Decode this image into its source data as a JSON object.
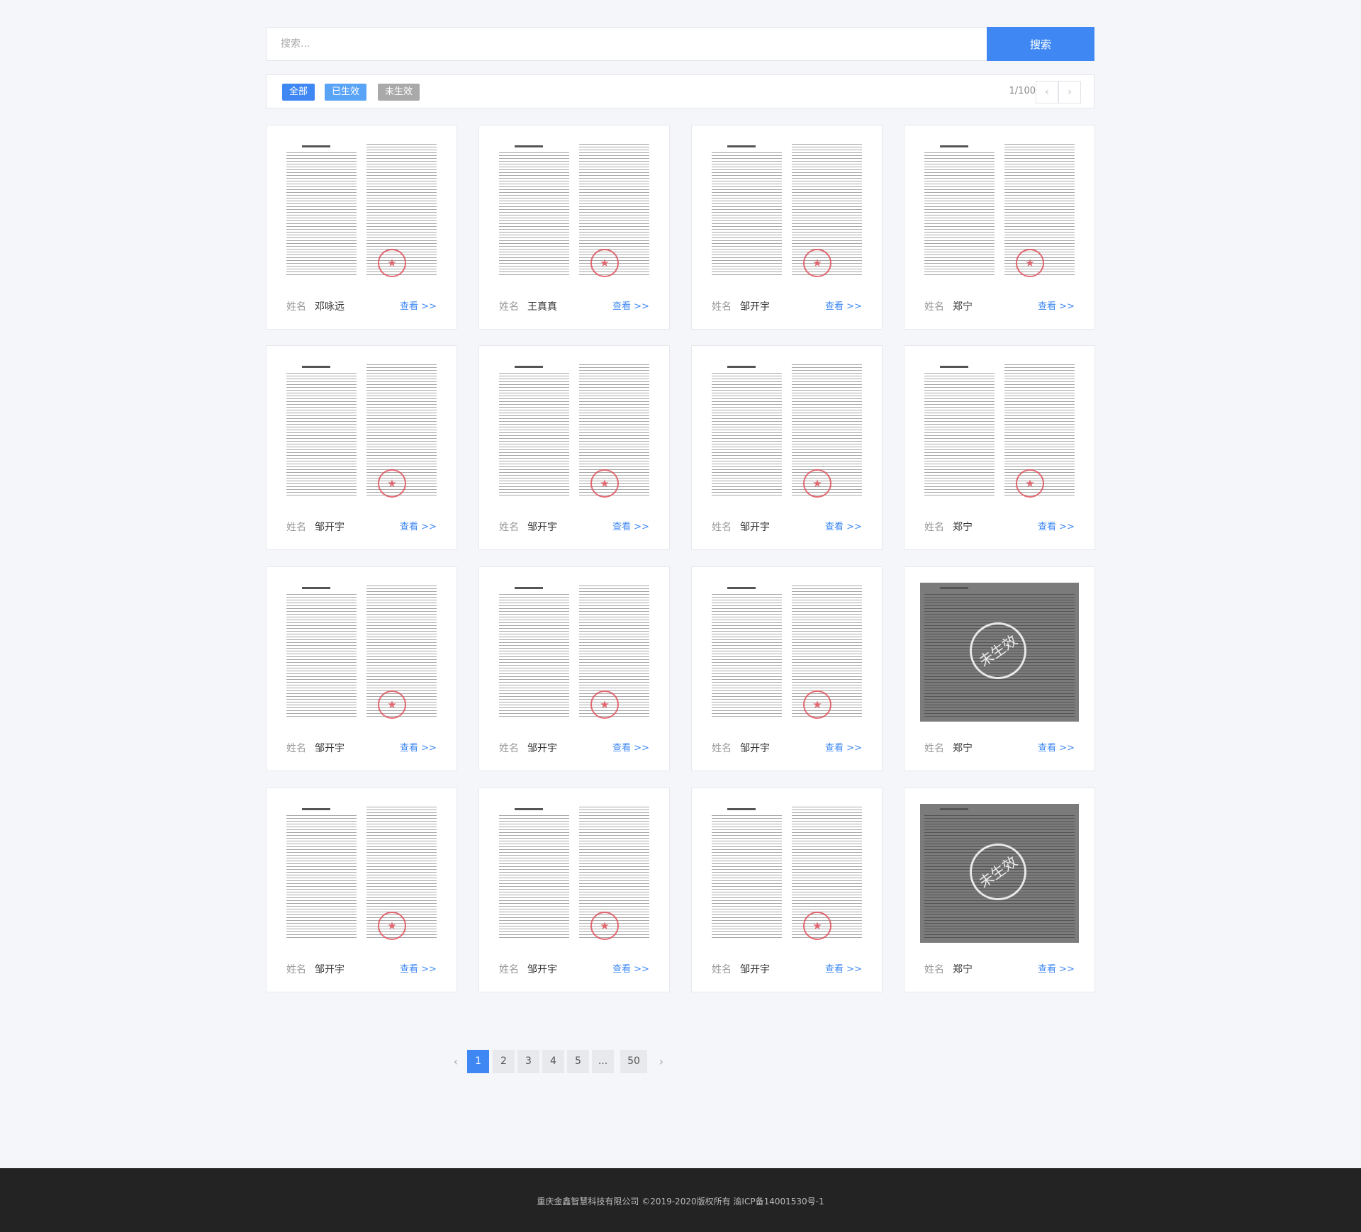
{
  "search": {
    "placeholder": "搜索...",
    "button_label": "搜索"
  },
  "filters": {
    "all": "全部",
    "active": "已生效",
    "inactive": "未生效"
  },
  "pager_top": {
    "indicator": "1/100",
    "prev": "‹",
    "next": "›"
  },
  "card_common": {
    "name_label": "姓名",
    "view_label": "查看 >>",
    "void_text": "未生效"
  },
  "cards": [
    {
      "name": "邓咏远",
      "status": "active"
    },
    {
      "name": "王真真",
      "status": "active"
    },
    {
      "name": "邹开宇",
      "status": "active"
    },
    {
      "name": "郑宁",
      "status": "active"
    },
    {
      "name": "邹开宇",
      "status": "active"
    },
    {
      "name": "邹开宇",
      "status": "active"
    },
    {
      "name": "邹开宇",
      "status": "active"
    },
    {
      "name": "郑宁",
      "status": "active"
    },
    {
      "name": "邹开宇",
      "status": "active"
    },
    {
      "name": "邹开宇",
      "status": "active"
    },
    {
      "name": "邹开宇",
      "status": "active"
    },
    {
      "name": "郑宁",
      "status": "inactive"
    },
    {
      "name": "邹开宇",
      "status": "active"
    },
    {
      "name": "邹开宇",
      "status": "active"
    },
    {
      "name": "邹开宇",
      "status": "active"
    },
    {
      "name": "郑宁",
      "status": "inactive"
    }
  ],
  "pagination": {
    "prev": "‹",
    "pages": [
      "1",
      "2",
      "3",
      "4",
      "5",
      "...",
      "50"
    ],
    "current": "1",
    "next": "›"
  },
  "footer": {
    "text": "重庆金鑫智慧科技有限公司 ©2019-2020版权所有 渝ICP备14001530号-1"
  }
}
